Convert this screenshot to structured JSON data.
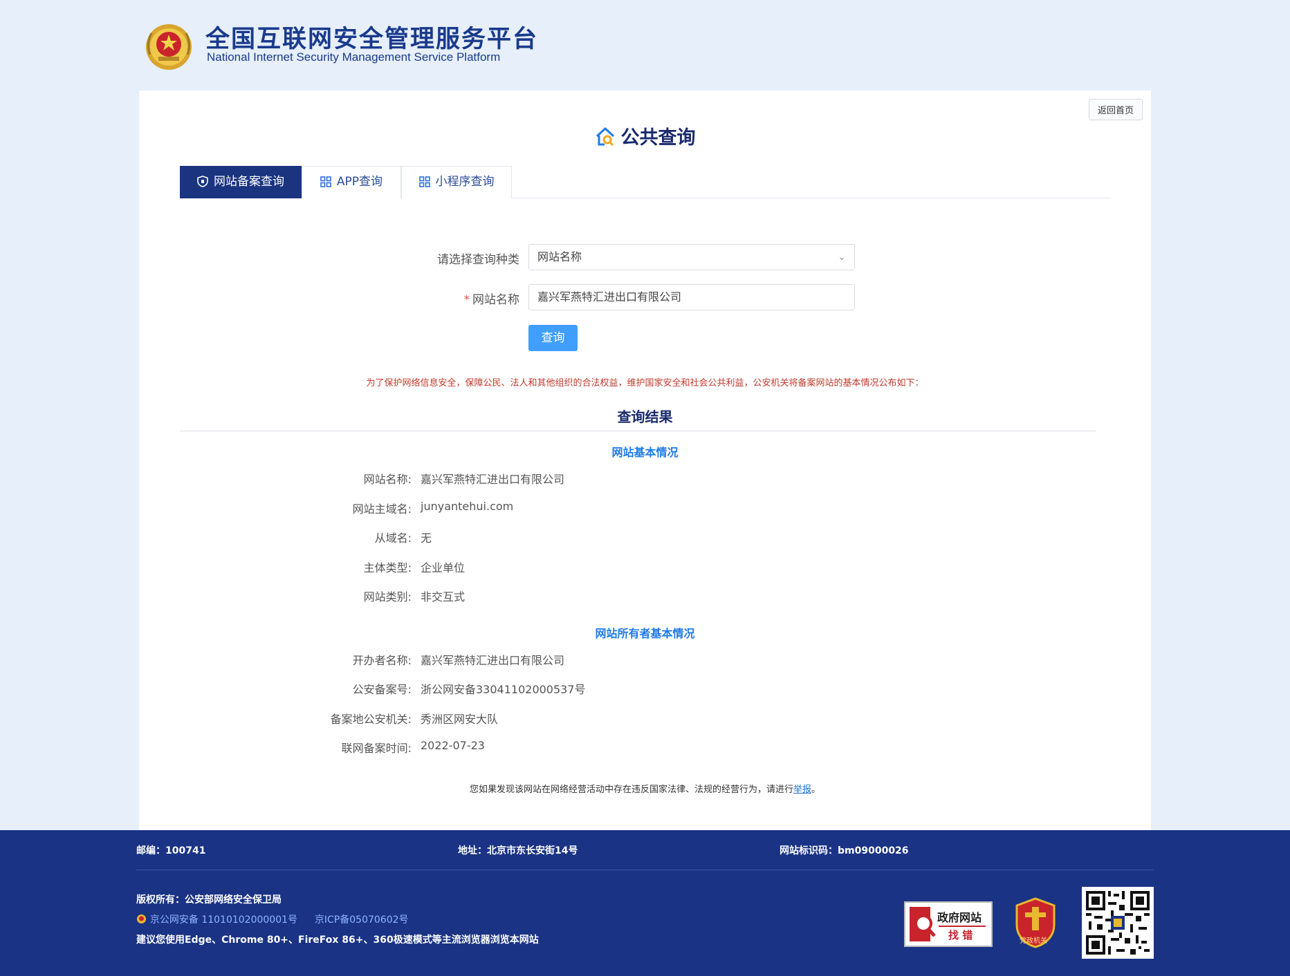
{
  "header": {
    "title": "全国互联网安全管理服务平台",
    "subtitle": "National Internet Security Management Service Platform"
  },
  "card": {
    "back_home": "返回首页",
    "heading": "公共查询",
    "tabs": [
      {
        "label": "网站备案查询",
        "icon": "shield-icon",
        "active": true
      },
      {
        "label": "APP查询",
        "icon": "grid-icon",
        "active": false
      },
      {
        "label": "小程序查询",
        "icon": "grid-icon",
        "active": false
      }
    ],
    "form": {
      "type_label": "请选择查询种类",
      "type_value": "网站名称",
      "name_required_mark": "*",
      "name_label": "网站名称",
      "name_value": "嘉兴军燕特汇进出口有限公司",
      "submit_label": "查询"
    },
    "notice": "为了保护网络信息安全，保障公民、法人和其他组织的合法权益，维护国家安全和社会公共利益，公安机关将备案网站的基本情况公布如下：",
    "result_title": "查询结果",
    "site_section": {
      "title": "网站基本情况",
      "rows": [
        {
          "k": "网站名称:",
          "v": "嘉兴军燕特汇进出口有限公司"
        },
        {
          "k": "网站主域名:",
          "v": "junyantehui.com"
        },
        {
          "k": "从域名:",
          "v": "无"
        },
        {
          "k": "主体类型:",
          "v": "企业单位"
        },
        {
          "k": "网站类别:",
          "v": "非交互式"
        }
      ]
    },
    "owner_section": {
      "title": "网站所有者基本情况",
      "rows": [
        {
          "k": "开办者名称:",
          "v": "嘉兴军燕特汇进出口有限公司"
        },
        {
          "k": "公安备案号:",
          "v": "浙公网安备33041102000537号"
        },
        {
          "k": "备案地公安机关:",
          "v": "秀洲区网安大队"
        },
        {
          "k": "联网备案时间:",
          "v": "2022-07-23"
        }
      ]
    },
    "report_text": "您如果发现该网站在网络经营活动中存在违反国家法律、法规的经营行为，请进行",
    "report_link": "举报",
    "report_end": "。"
  },
  "footer": {
    "postcode": "邮编：100741",
    "address": "地址：北京市东长安街14号",
    "site_id": "网站标识码：bm09000026",
    "copyright": "版权所有：公安部网络安全保卫局",
    "police_record": "京公网安备 11010102000001号",
    "icp_record": "京ICP备05070602号",
    "browser_tip": "建议您使用Edge、Chrome 80+、FireFox 86+、360极速模式等主流浏览器浏览本网站",
    "badge_gov_line1": "政府网站",
    "badge_gov_line2": "找 错",
    "badge_party": "党政机关"
  },
  "colors": {
    "brand_navy": "#1a3480",
    "footer_bg": "#1a3384",
    "accent_blue": "#409eff",
    "notice_red": "#c0392b",
    "section_blue": "#1e7ae8"
  }
}
